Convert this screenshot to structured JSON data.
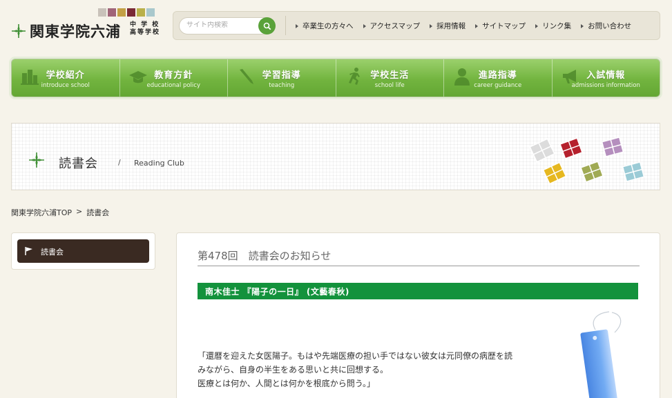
{
  "header": {
    "school_name": "関東学院六浦",
    "school_sub_1": "中 学 校",
    "school_sub_2": "高等学校",
    "logo_square_colors": [
      "#c9c2ba",
      "#a06478",
      "#c3a046",
      "#7a2a36",
      "#b9b04a",
      "#a9c8cc"
    ],
    "search_placeholder": "サイト内検索",
    "links": [
      {
        "label": "卒業生の方々へ"
      },
      {
        "label": "アクセスマップ"
      },
      {
        "label": "採用情報"
      },
      {
        "label": "サイトマップ"
      },
      {
        "label": "リンク集"
      },
      {
        "label": "お問い合わせ"
      }
    ]
  },
  "nav": {
    "items": [
      {
        "label": "学校紹介",
        "sub": "introduce school",
        "icon": "building-icon"
      },
      {
        "label": "教育方針",
        "sub": "educational policy",
        "icon": "graduation-cap-icon"
      },
      {
        "label": "学習指導",
        "sub": "teaching",
        "icon": "pen-icon"
      },
      {
        "label": "学校生活",
        "sub": "school life",
        "icon": "runner-icon"
      },
      {
        "label": "進路指導",
        "sub": "career guidance",
        "icon": "person-icon"
      },
      {
        "label": "入試情報",
        "sub": "admissions information",
        "icon": "megaphone-icon"
      }
    ]
  },
  "banner": {
    "title": "読書会",
    "separator": "/",
    "subtitle_en": "Reading Club"
  },
  "breadcrumb": {
    "home": "関東学院六浦TOP",
    "separator": ">",
    "current": "読書会"
  },
  "sidebar": {
    "items": [
      {
        "label": "読書会"
      }
    ]
  },
  "content": {
    "title": "第478回　読書会のお知らせ",
    "book": "南木佳士 『陽子の一日』 (文藝春秋)",
    "quote_lines": [
      "「還暦を迎えた女医陽子。もはや先端医療の担い手ではない彼女は元同僚の病歴を読",
      "みながら、自身の半生をある思いと共に回想する。",
      "医療とは何か、人間とは何かを根底から問う。」"
    ]
  },
  "colors": {
    "accent_green": "#13923c",
    "nav_green": "#72b43f",
    "sidebar_dark": "#3a2a22",
    "background": "#f6f3ea"
  }
}
